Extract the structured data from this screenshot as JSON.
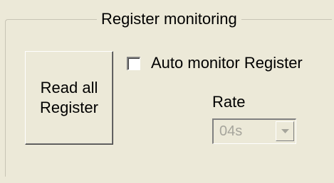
{
  "group": {
    "title": "Register monitoring"
  },
  "read_button": {
    "label": "Read all\nRegister"
  },
  "auto_monitor": {
    "label": "Auto monitor Register",
    "checked": false
  },
  "rate": {
    "label": "Rate",
    "selected": "04s",
    "enabled": false,
    "arrow_icon": "chevron-down-icon"
  }
}
